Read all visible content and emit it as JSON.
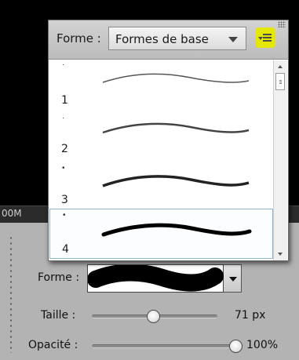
{
  "background": {
    "strip_label": "00M"
  },
  "brush_picker": {
    "shape_label": "Forme :",
    "library_selected": "Formes de base",
    "menu_icon": "panel-menu-icon",
    "accent_color": "#e4e800",
    "brushes": [
      {
        "dot": "·",
        "number": "1"
      },
      {
        "dot": "·",
        "number": "2"
      },
      {
        "dot": "•",
        "number": "3"
      },
      {
        "dot": "•",
        "number": "4"
      }
    ],
    "selected_index": 3
  },
  "options": {
    "shape_label": "Forme :",
    "size_label": "Taille :",
    "size_value": "71 px",
    "size_level": 0.43,
    "opacity_label": "Opacité :",
    "opacity_value": "100%",
    "opacity_level": 1.0
  }
}
